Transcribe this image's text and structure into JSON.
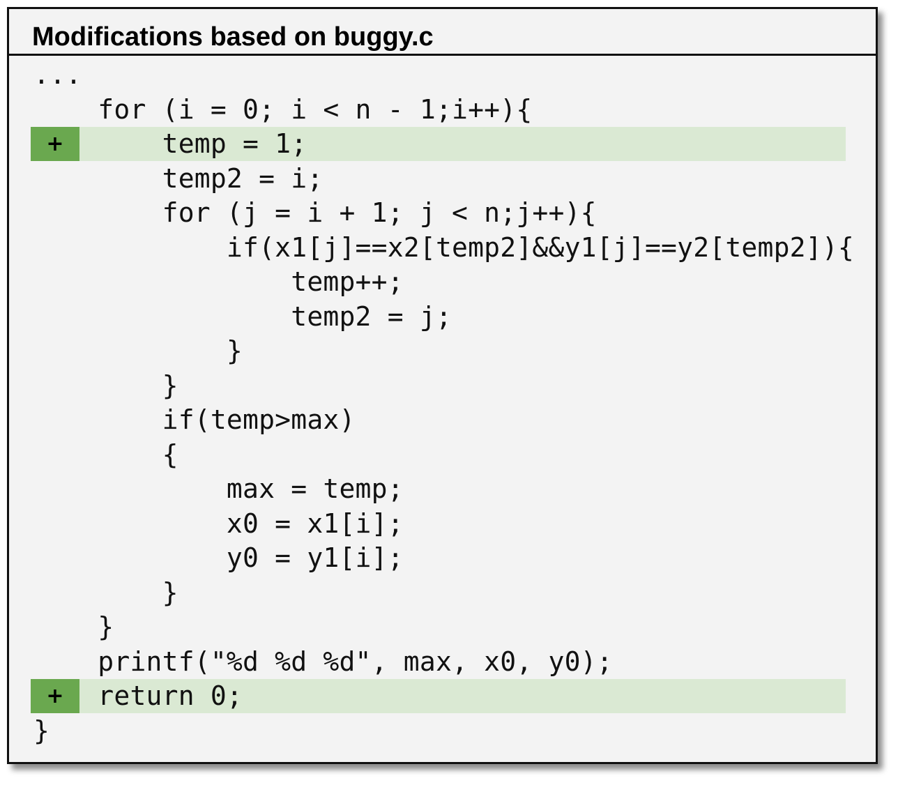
{
  "panel": {
    "title": "Modifications based on buggy.c",
    "marker_symbol": "+",
    "added_line_color": "#dae9d3",
    "marker_color": "#6aa84f"
  },
  "code_lines": [
    {
      "text": "...",
      "added": false
    },
    {
      "text": "    for (i = 0; i < n - 1;i++){",
      "added": false
    },
    {
      "text": "        temp = 1;",
      "added": true
    },
    {
      "text": "        temp2 = i;",
      "added": false
    },
    {
      "text": "        for (j = i + 1; j < n;j++){",
      "added": false
    },
    {
      "text": "            if(x1[j]==x2[temp2]&&y1[j]==y2[temp2]){",
      "added": false
    },
    {
      "text": "                temp++;",
      "added": false
    },
    {
      "text": "                temp2 = j;",
      "added": false
    },
    {
      "text": "            }",
      "added": false
    },
    {
      "text": "        }",
      "added": false
    },
    {
      "text": "        if(temp>max)",
      "added": false
    },
    {
      "text": "        {",
      "added": false
    },
    {
      "text": "            max = temp;",
      "added": false
    },
    {
      "text": "            x0 = x1[i];",
      "added": false
    },
    {
      "text": "            y0 = y1[i];",
      "added": false
    },
    {
      "text": "        }",
      "added": false
    },
    {
      "text": "    }",
      "added": false
    },
    {
      "text": "    printf(\"%d %d %d\", max, x0, y0);",
      "added": false
    },
    {
      "text": "    return 0;",
      "added": true
    },
    {
      "text": "}",
      "added": false
    }
  ]
}
